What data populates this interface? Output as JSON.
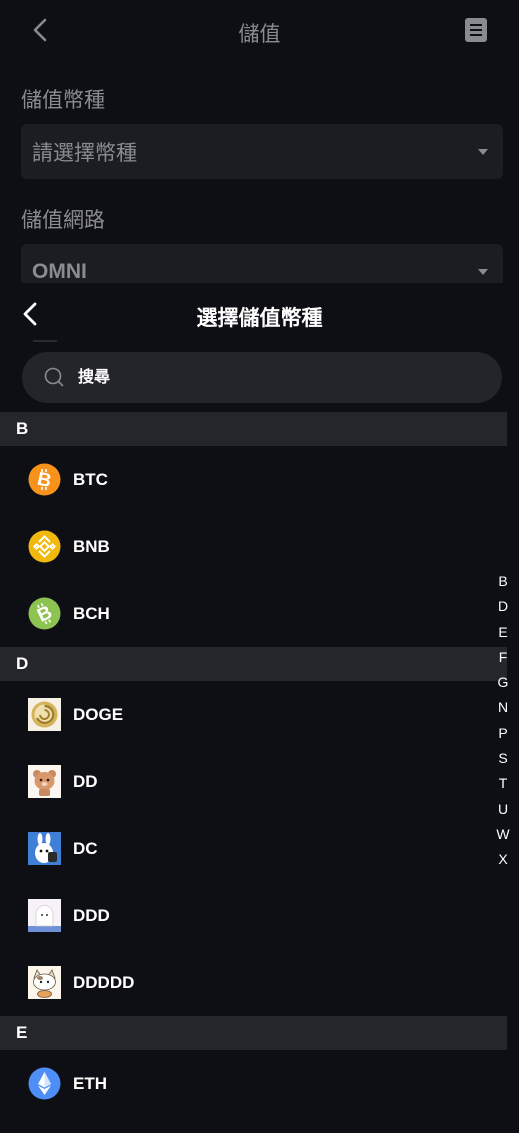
{
  "background_page": {
    "title": "儲值",
    "currency_label": "儲值幣種",
    "currency_placeholder": "請選擇幣種",
    "network_label": "儲值網路",
    "network_value": "OMNI",
    "icons": [
      "back-icon",
      "document-icon",
      "caret-down-icon"
    ]
  },
  "sheet": {
    "title": "選擇儲值幣種",
    "search_placeholder": "搜尋",
    "sections": [
      {
        "letter": "B",
        "items": [
          {
            "name": "BTC",
            "icon": "btc-icon",
            "color": "#f7931a"
          },
          {
            "name": "BNB",
            "icon": "bnb-icon",
            "color": "#f0b90b"
          },
          {
            "name": "BCH",
            "icon": "bch-icon",
            "color": "#8dc351"
          }
        ]
      },
      {
        "letter": "D",
        "items": [
          {
            "name": "DOGE",
            "icon": "doge-icon"
          },
          {
            "name": "DD",
            "icon": "dd-bear-icon"
          },
          {
            "name": "DC",
            "icon": "dc-rabbit-icon"
          },
          {
            "name": "DDD",
            "icon": "ddd-ghost-icon"
          },
          {
            "name": "DDDDD",
            "icon": "ddddd-cat-icon"
          }
        ]
      },
      {
        "letter": "E",
        "items": [
          {
            "name": "ETH",
            "icon": "eth-icon",
            "color": "#4e8ef7"
          }
        ]
      }
    ],
    "alpha_index": [
      "B",
      "D",
      "E",
      "F",
      "G",
      "N",
      "P",
      "S",
      "T",
      "U",
      "W",
      "X"
    ]
  },
  "colors": {
    "background": "#0e0f14",
    "section_header": "#25262b",
    "input_bg": "#1c1d22",
    "muted_text": "#8a8b90"
  }
}
